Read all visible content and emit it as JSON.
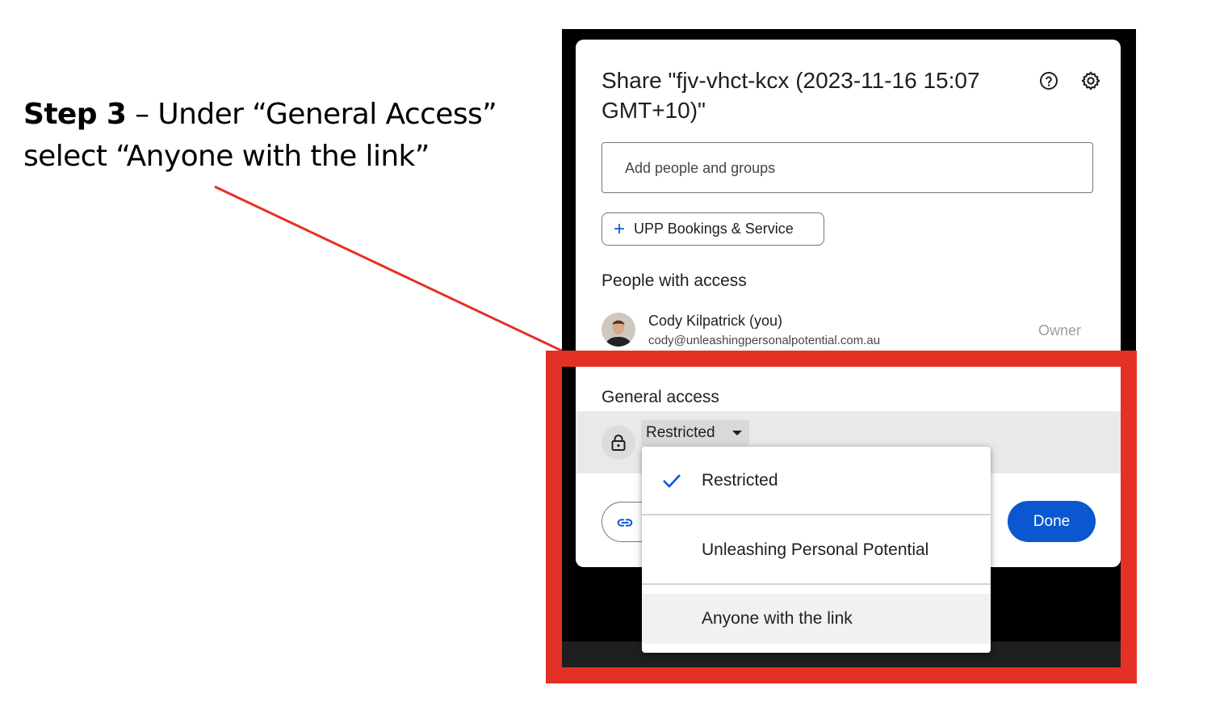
{
  "instruction": {
    "step": "Step 3",
    "text_line1": " – Under “General Access”",
    "text_line2": "select “Anyone with the link”"
  },
  "colors": {
    "annotation": "#e43125",
    "primary": "#0b57d0",
    "backdrop": "#000000"
  },
  "dialog": {
    "title": "Share \"fjv-vhct-kcx (2023-11-16 15:07 GMT+10)\"",
    "help_icon": "help-circle-icon",
    "settings_icon": "gear-icon",
    "add_people_placeholder": "Add people and groups",
    "group_chip": "UPP Bookings & Service",
    "people_heading": "People with access",
    "person": {
      "name": "Cody Kilpatrick (you)",
      "email": "cody@unleashingpersonalpotential.com.au",
      "role": "Owner"
    },
    "general_access_heading": "General access",
    "access_selected": "Restricted",
    "done_label": "Done"
  },
  "access_menu": {
    "options": [
      {
        "label": "Restricted",
        "checked": true
      },
      {
        "label": "Unleashing Personal Potential",
        "checked": false
      },
      {
        "label": "Anyone with the link",
        "checked": false,
        "hovered": true
      }
    ]
  }
}
